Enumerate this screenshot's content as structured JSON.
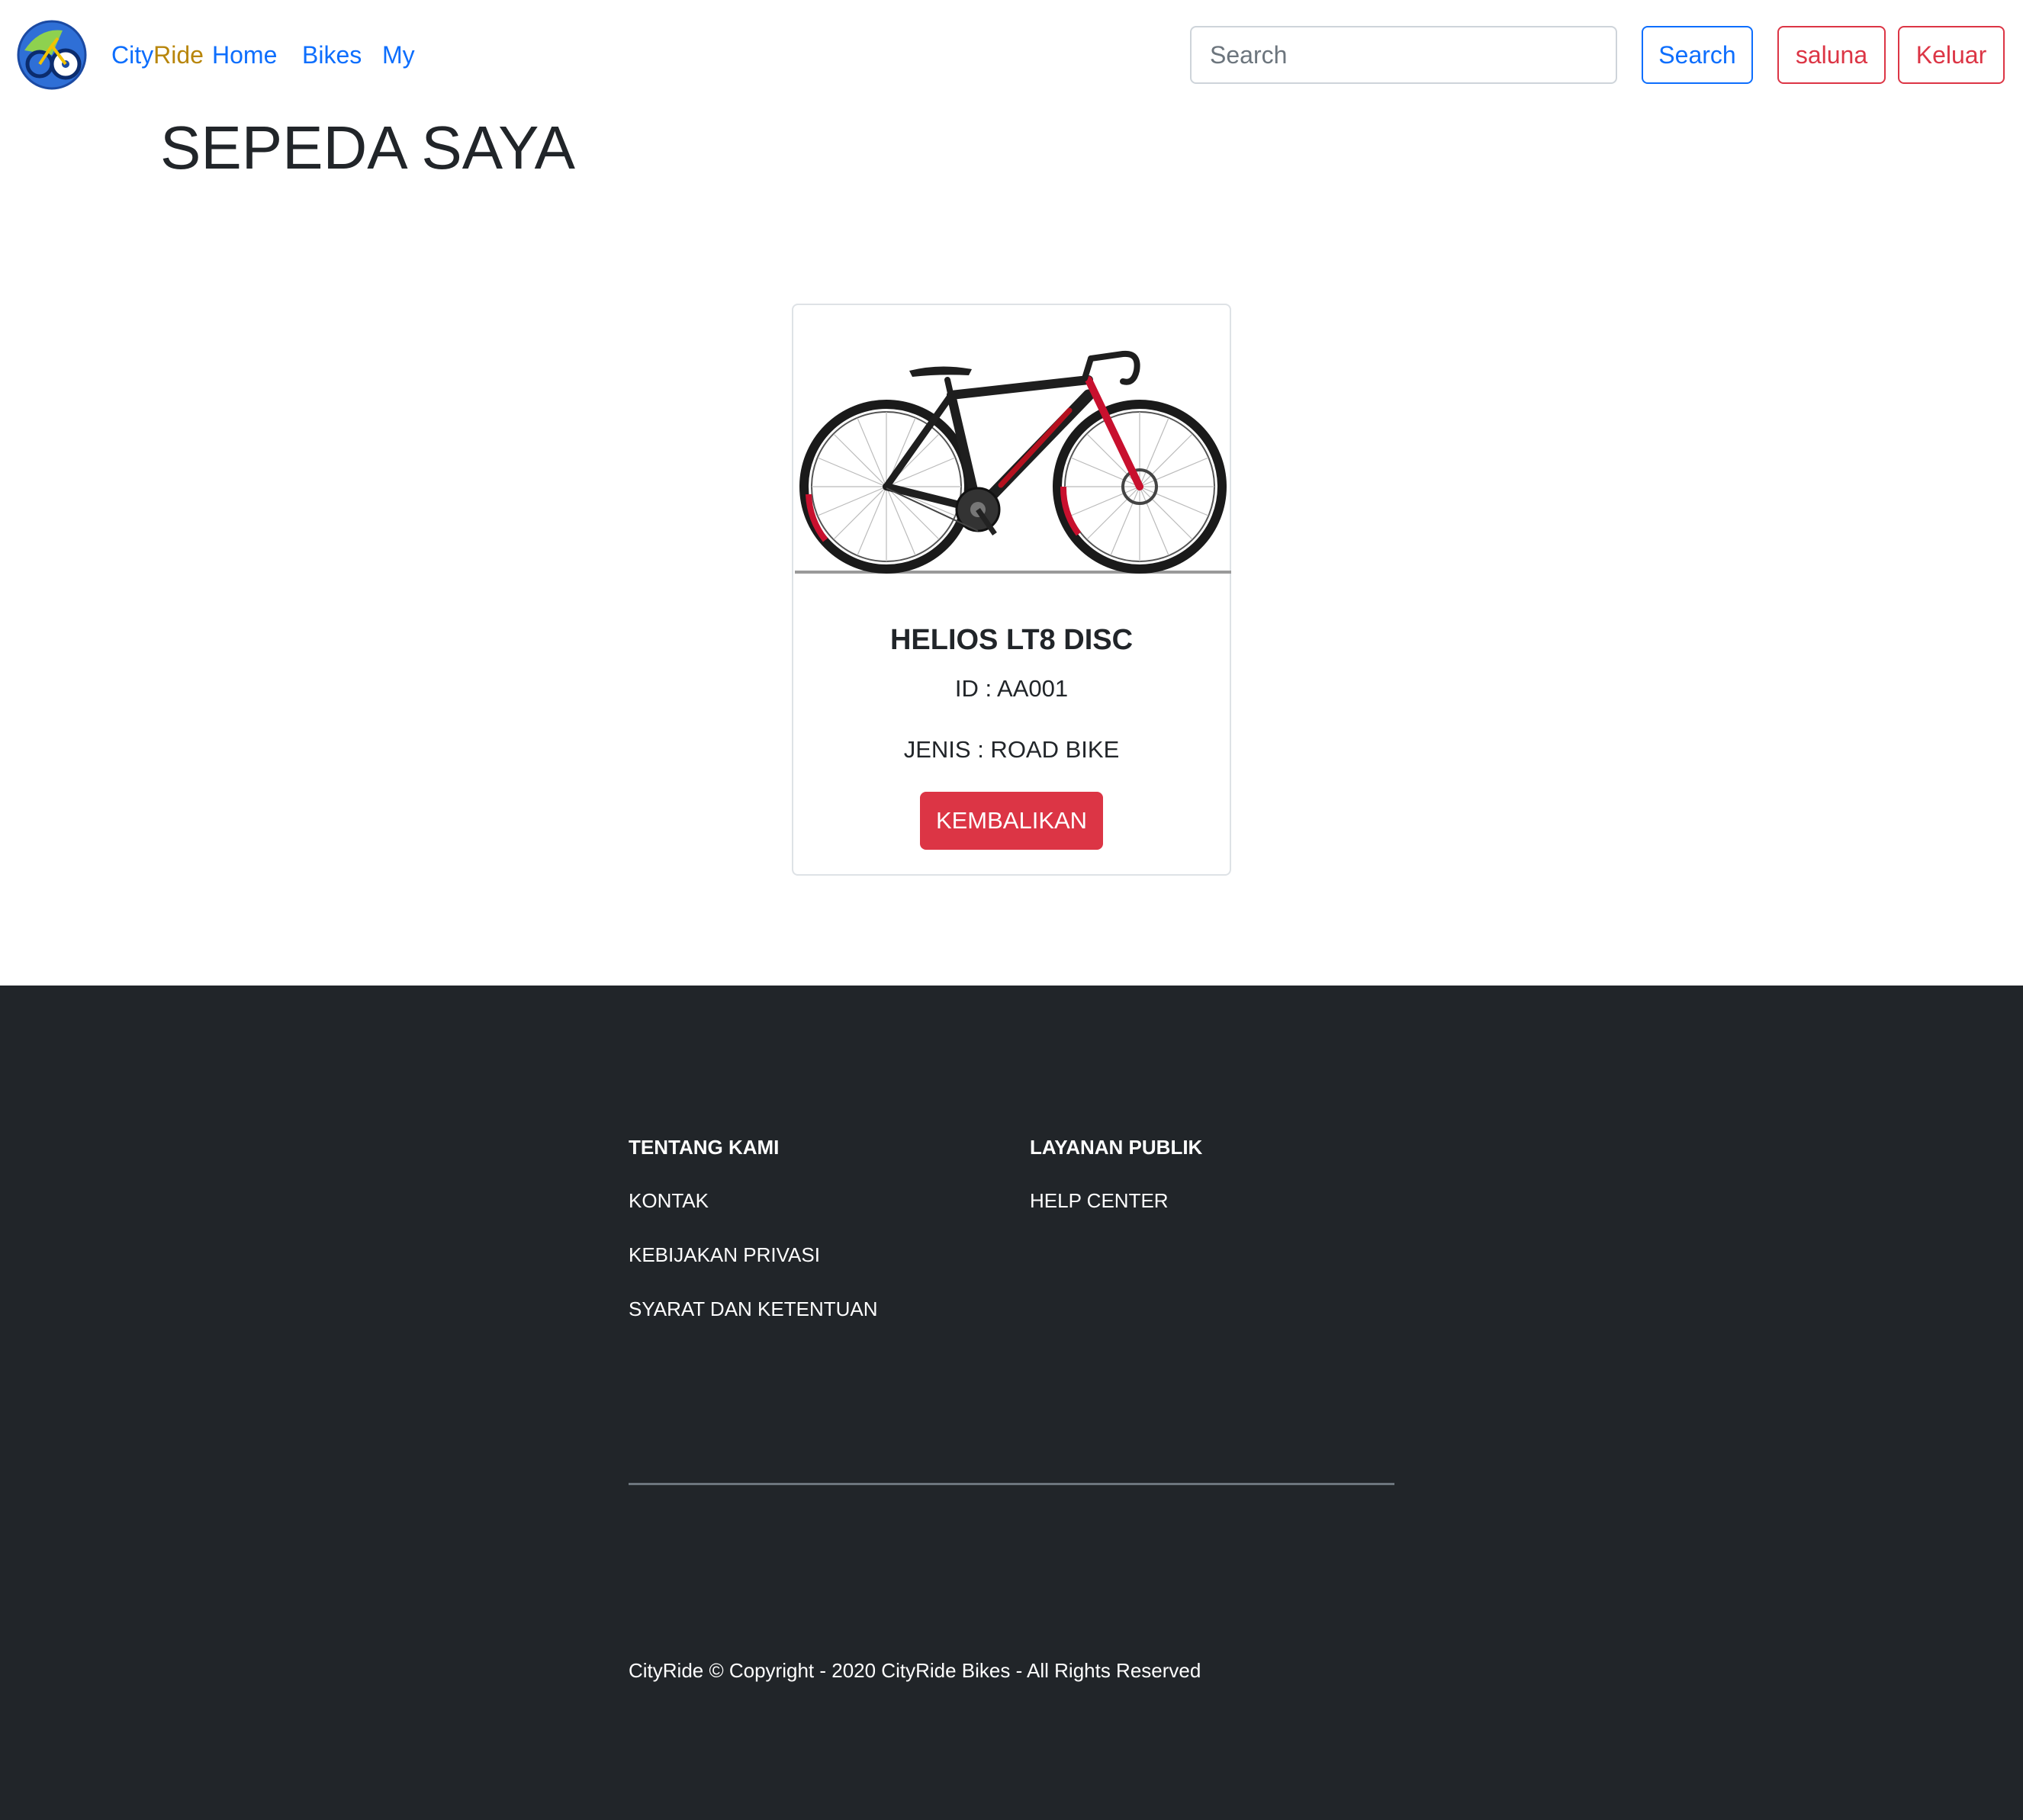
{
  "header": {
    "brand_part1": "City",
    "brand_part2": "Ride",
    "nav": [
      "Home",
      "Bikes",
      "My"
    ],
    "search_placeholder": "Search",
    "search_button": "Search",
    "username_button": "saluna",
    "logout_button": "Keluar",
    "colors": {
      "primary": "#0d6efd",
      "danger": "#dc3545",
      "brand_accent": "#b8860b"
    }
  },
  "page": {
    "title": "SEPEDA SAYA"
  },
  "bike_card": {
    "image": "road-bike-image",
    "name": "HELIOS LT8 DISC",
    "id_text": "ID : AA001",
    "type_text": "JENIS : ROAD BIKE",
    "return_button": "KEMBALIKAN"
  },
  "footer": {
    "background": "#212529",
    "col1": {
      "heading": "TENTANG KAMI",
      "links": [
        "KONTAK",
        "KEBIJAKAN PRIVASI",
        "SYARAT DAN KETENTUAN"
      ]
    },
    "col2": {
      "heading": "LAYANAN PUBLIK",
      "links": [
        "HELP CENTER"
      ]
    },
    "copyright": "CityRide © Copyright - 2020 CityRide Bikes - All Rights Reserved"
  }
}
